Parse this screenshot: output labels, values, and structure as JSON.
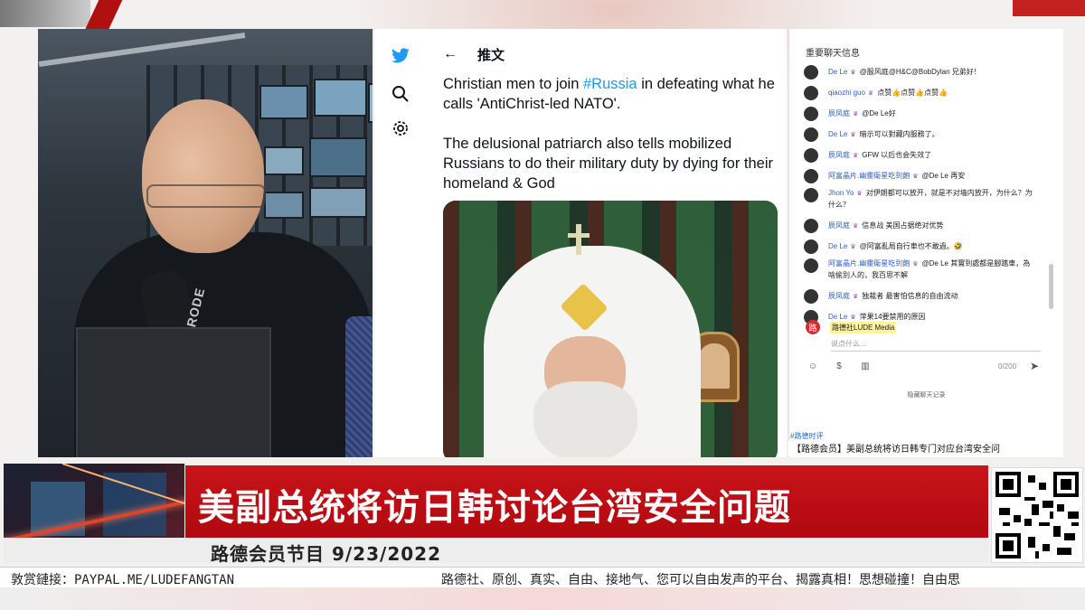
{
  "twitter": {
    "header_back": "←",
    "header_title": "推文",
    "text_line1_prefix": "Christian men to join ",
    "hashtag": "#Russia",
    "text_line1_suffix": " in defeating what he calls 'AntiChrist-led NATO'.",
    "text_para2": "The delusional patriarch also tells mobilized Russians to do their military duty by dying for their homeland & God",
    "icons": [
      "twitter-bird-icon",
      "search-icon",
      "gear-icon"
    ]
  },
  "chat": {
    "title": "重要聊天信息",
    "messages": [
      {
        "name": "De Le",
        "text": "@服风庭@H&C@BobDylan 兄弟好！"
      },
      {
        "name": "qiaozhi guo",
        "text": "点赞👍点赞👍点赞👍"
      },
      {
        "name": "辰凤庭",
        "text": "@De Le好"
      },
      {
        "name": "De Le",
        "text": "暗示可以對藏内服務了。"
      },
      {
        "name": "辰凤庭",
        "text": "GFW 以后也会失效了"
      },
      {
        "name": "阿富晶片.幽靈衛星吃到飽",
        "text": "@De Le 再安"
      },
      {
        "name": "Jhon Yo",
        "text": "对伊朗都可以放开，就是不对墙内放开，为什么？为什么？"
      },
      {
        "name": "辰凤庭",
        "text": "信息战 美国占据绝对优势"
      },
      {
        "name": "De Le",
        "text": "@阿富亂局自行車也不敢過。🤣"
      },
      {
        "name": "阿富晶片.幽靈衛星吃到飽",
        "text": "@De Le 其實到處都是腳踏車，為啥偷別人的，我百思不解"
      },
      {
        "name": "辰凤庭",
        "text": "独裁者 最害怕信息的自由流动"
      },
      {
        "name": "De Le",
        "text": "萍果14要禁用的原因"
      }
    ],
    "host_name": "路德社LUDE Media",
    "input_placeholder": "说点什么...",
    "char_count": "0/200",
    "history_label": "隐藏聊天记录"
  },
  "side": {
    "tag": "#路德时评",
    "news": "【路德会员】美副总统将访日韩专门对应台湾安全问"
  },
  "lower_third": {
    "headline": "美副总统将访日韩讨论台湾安全问题",
    "program": "路德会员节目 9/23/2022"
  },
  "ticker": {
    "left": "敦赏鏈接：PAYPAL.ME/LUDEFANGTAN",
    "right": "路德社、原创、真实、自由、接地气、您可以自由发声的平台、揭露真相！思想碰撞！自由思"
  },
  "webcam": {
    "mic_label": "RODE"
  },
  "colors": {
    "banner_red": "#c8141a",
    "twitter_blue": "#1d9bf0",
    "chat_name_blue": "#3060c0"
  }
}
